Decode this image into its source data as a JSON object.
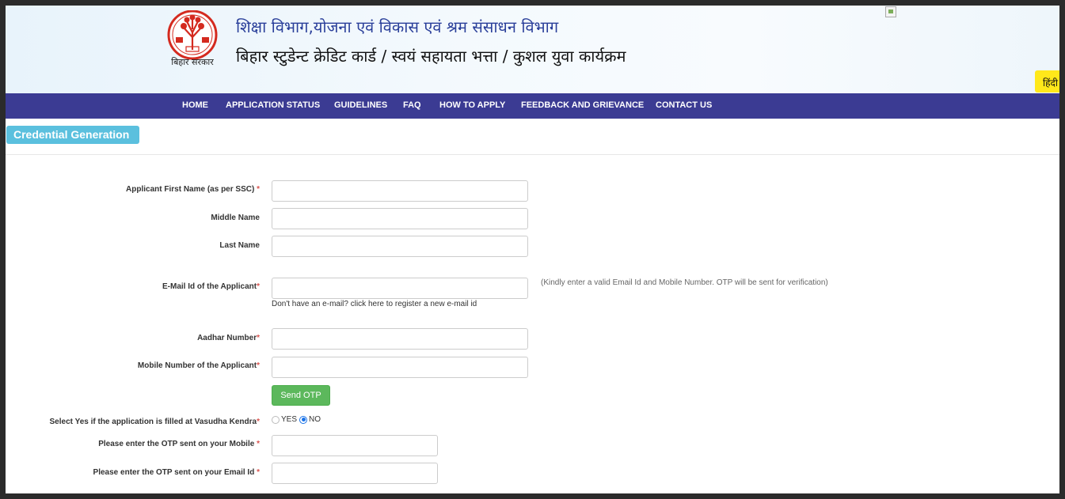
{
  "header": {
    "dept_title": "शिक्षा विभाग,योजना एवं विकास एवं श्रम संसाधन विभाग",
    "scheme_title": "बिहार स्टुडेन्ट क्रेडिट कार्ड / स्वयं सहायता भत्ता / कुशल युवा कार्यक्रम",
    "emblem_caption": "बिहार सरकार",
    "language_button": "हिंदी"
  },
  "nav": {
    "items": [
      "HOME",
      "APPLICATION STATUS",
      "GUIDELINES",
      "FAQ",
      "HOW TO APPLY",
      "FEEDBACK AND GRIEVANCE",
      "CONTACT US"
    ]
  },
  "section_title": "Credential Generation",
  "form": {
    "first_name_label": "Applicant First Name (as per SSC)",
    "middle_name_label": "Middle Name",
    "last_name_label": "Last Name",
    "email_label": "E-Mail Id of the Applicant",
    "email_note": "(Kindly enter a valid Email Id and Mobile Number. OTP will be sent for verification)",
    "email_register_link": "Don't have an e-mail? click here to register a new e-mail id",
    "aadhar_label": "Aadhar Number",
    "mobile_label": "Mobile Number of the Applicant",
    "send_otp_label": "Send OTP",
    "vasudha_label": "Select Yes if the application is filled at Vasudha Kendra",
    "vasudha_options": [
      "YES",
      "NO"
    ],
    "vasudha_selected": "NO",
    "otp_mobile_label": "Please enter the OTP sent on your Mobile",
    "otp_email_label": "Please enter the OTP sent on your Email Id",
    "required_marker": "*"
  },
  "colors": {
    "nav_bg": "#3b3b93",
    "tab_bg": "#5bc0de",
    "button_green": "#5cb85c",
    "required_red": "#d9534f",
    "language_yellow": "#ffe81a"
  }
}
